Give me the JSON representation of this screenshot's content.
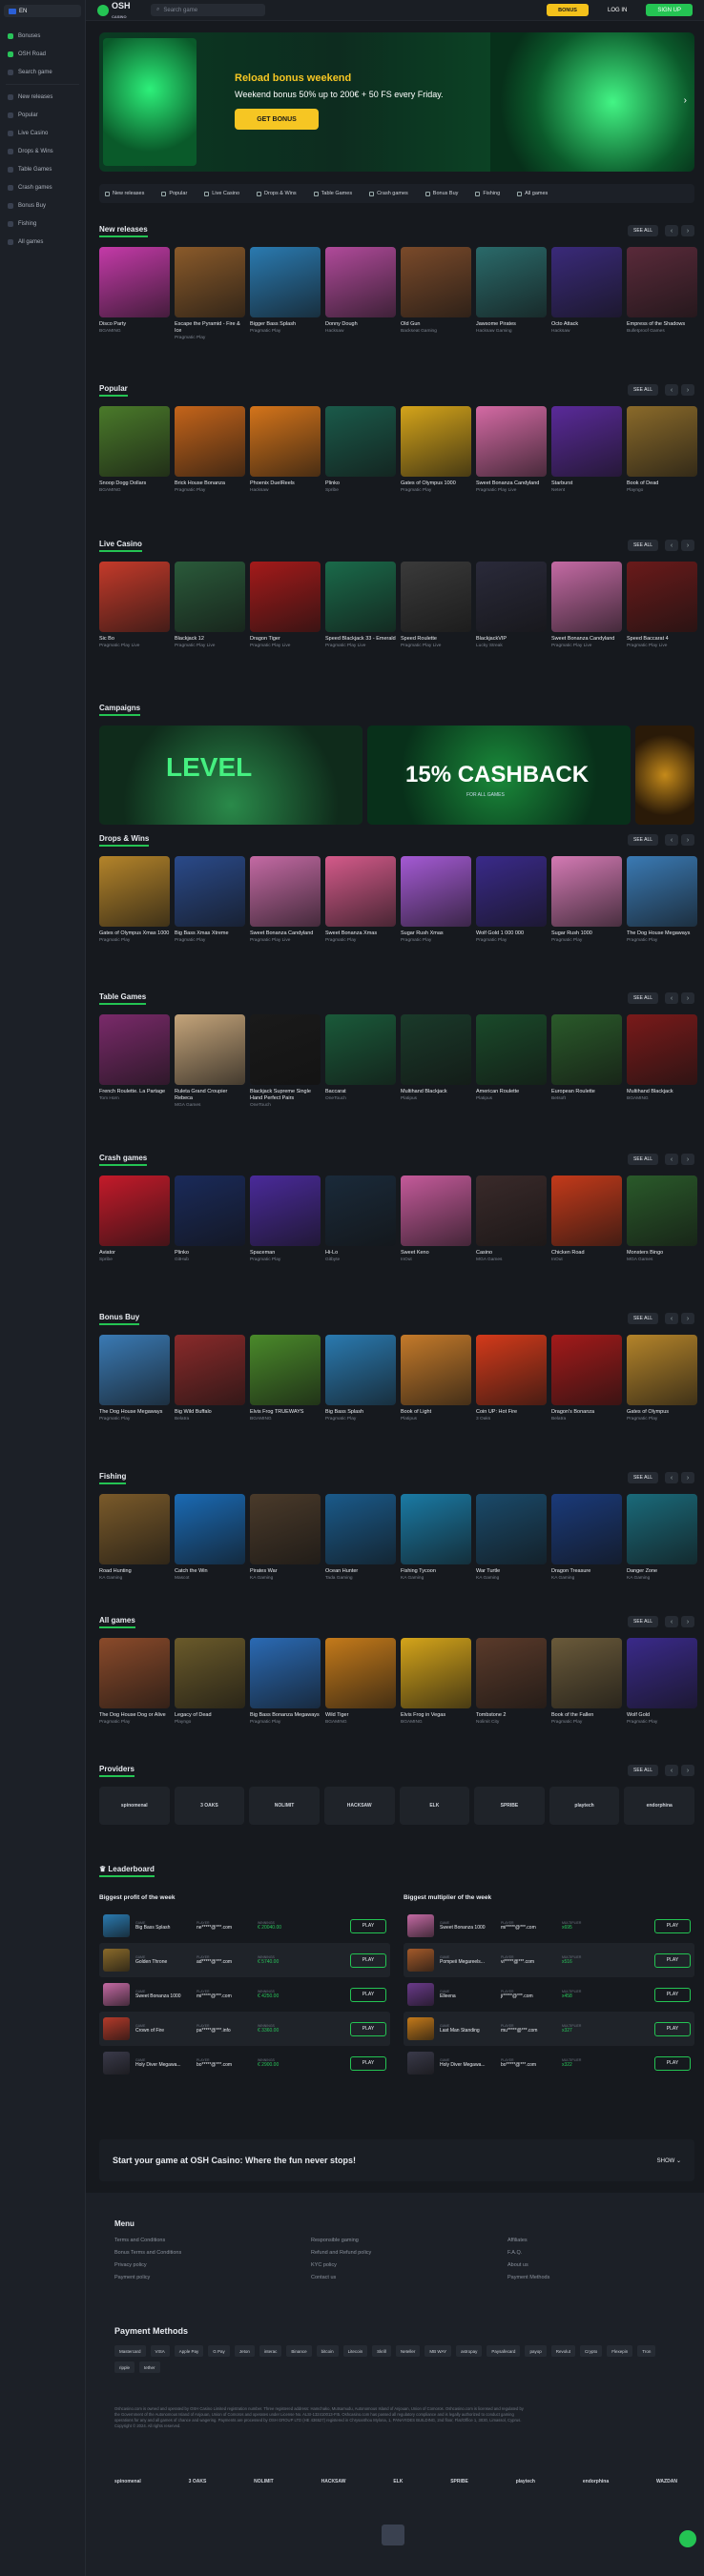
{
  "sidebar": {
    "lang": "EN",
    "items": [
      {
        "label": "Bonuses"
      },
      {
        "label": "OSH Road"
      },
      {
        "label": "Search game"
      },
      {
        "label": "New releases"
      },
      {
        "label": "Popular"
      },
      {
        "label": "Live Casino"
      },
      {
        "label": "Drops & Wins"
      },
      {
        "label": "Table Games"
      },
      {
        "label": "Crash games"
      },
      {
        "label": "Bonus Buy"
      },
      {
        "label": "Fishing"
      },
      {
        "label": "All games"
      }
    ]
  },
  "header": {
    "logo": "OSH",
    "logo_sub": "CASINO",
    "search_placeholder": "Search game",
    "bonus": "BONUS",
    "login": "LOG IN",
    "signup": "SIGN UP"
  },
  "hero": {
    "title": "Reload bonus weekend",
    "text": "Weekend bonus 50% up to 200€ + 50 FS every Friday.",
    "button": "GET BONUS"
  },
  "categories": [
    "New releases",
    "Popular",
    "Live Casino",
    "Drops & Wins",
    "Table Games",
    "Crash games",
    "Bonus Buy",
    "Fishing",
    "All games"
  ],
  "see_all": "SEE ALL",
  "sections": [
    {
      "title": "New releases",
      "games": [
        {
          "n": "Disco Party",
          "p": "BGAMING",
          "c": "#c43aa8"
        },
        {
          "n": "Escape the Pyramid - Fire & Ice",
          "p": "Pragmatic Play",
          "c": "#8a5a2a"
        },
        {
          "n": "Bigger Bass Splash",
          "p": "Pragmatic Play",
          "c": "#2a7ab0"
        },
        {
          "n": "Donny Dough",
          "p": "Hacksaw",
          "c": "#b04a9a"
        },
        {
          "n": "Old Gun",
          "p": "Backseat Gaming",
          "c": "#7a4a2a"
        },
        {
          "n": "Jawsome Pirates",
          "p": "Hacksaw Gaming",
          "c": "#2a6a6a"
        },
        {
          "n": "Octo Attack",
          "p": "Hacksaw",
          "c": "#3a2a7a"
        },
        {
          "n": "Empress of the Shadows",
          "p": "Bulletproof Games",
          "c": "#5a2a3a"
        }
      ]
    },
    {
      "title": "Popular",
      "games": [
        {
          "n": "Snoop Dogg Dollars",
          "p": "BGAMING",
          "c": "#4a7a2a"
        },
        {
          "n": "Brick House Bonanza",
          "p": "Pragmatic Play",
          "c": "#c4641a"
        },
        {
          "n": "Phoenix DuelReels",
          "p": "Hacksaw",
          "c": "#d4741a"
        },
        {
          "n": "Plinko",
          "p": "Spribe",
          "c": "#1a5a4a"
        },
        {
          "n": "Gates of Olympus 1000",
          "p": "Pragmatic Play",
          "c": "#d4a41a"
        },
        {
          "n": "Sweet Bonanza Candyland",
          "p": "Pragmatic Play Live",
          "c": "#d46aa4"
        },
        {
          "n": "Starburst",
          "p": "Netent",
          "c": "#5a2a9a"
        },
        {
          "n": "Book of Dead",
          "p": "Playngo",
          "c": "#8a6a2a"
        }
      ]
    },
    {
      "title": "Live Casino",
      "games": [
        {
          "n": "Sic Bo",
          "p": "Pragmatic Play Live",
          "c": "#c43a2a"
        },
        {
          "n": "Blackjack 12",
          "p": "Pragmatic Play Live",
          "c": "#2a5a3a"
        },
        {
          "n": "Dragon Tiger",
          "p": "Pragmatic Play Live",
          "c": "#a41a1a"
        },
        {
          "n": "Speed Blackjack 33 - Emerald",
          "p": "Pragmatic Play Live",
          "c": "#1a6a4a"
        },
        {
          "n": "Speed Roulette",
          "p": "Pragmatic Play Live",
          "c": "#3a3a3a"
        },
        {
          "n": "BlackjackVIP",
          "p": "Lucky Streak",
          "c": "#2a2a3a"
        },
        {
          "n": "Sweet Bonanza Candyland",
          "p": "Pragmatic Play Live",
          "c": "#c46aa4"
        },
        {
          "n": "Speed Baccarat 4",
          "p": "Pragmatic Play Live",
          "c": "#6a1a1a"
        }
      ]
    },
    {
      "title": "Drops & Wins",
      "games": [
        {
          "n": "Gates of Olympus Xmas 1000",
          "p": "Pragmatic Play",
          "c": "#b4842a"
        },
        {
          "n": "Big Bass Xmas Xtreme",
          "p": "Pragmatic Play",
          "c": "#2a4a8a"
        },
        {
          "n": "Sweet Bonanza Candyland",
          "p": "Pragmatic Play Live",
          "c": "#c46aa4"
        },
        {
          "n": "Sweet Bonanza Xmas",
          "p": "Pragmatic Play",
          "c": "#d45a8a"
        },
        {
          "n": "Sugar Rush Xmas",
          "p": "Pragmatic Play",
          "c": "#a45ad4"
        },
        {
          "n": "Wolf Gold 1 000 000",
          "p": "Pragmatic Play",
          "c": "#3a2a8a"
        },
        {
          "n": "Sugar Rush 1000",
          "p": "Pragmatic Play",
          "c": "#d47ab4"
        },
        {
          "n": "The Dog House Megaways",
          "p": "Pragmatic Play",
          "c": "#3a7ab4"
        }
      ]
    },
    {
      "title": "Table Games",
      "games": [
        {
          "n": "French Roulette. La Partage",
          "p": "Tom Horn",
          "c": "#7a2a6a"
        },
        {
          "n": "Ruleta Grand Croupier Rebeca",
          "p": "MGA Games",
          "c": "#c4a47a"
        },
        {
          "n": "Blackjack Supreme Single Hand Perfect Pairs",
          "p": "OneTouch",
          "c": "#1a1a1a"
        },
        {
          "n": "Baccarat",
          "p": "OneTouch",
          "c": "#1a5a3a"
        },
        {
          "n": "Multihand Blackjack",
          "p": "Platipus",
          "c": "#1a3a2a"
        },
        {
          "n": "American Roulette",
          "p": "Platipus",
          "c": "#1a4a2a"
        },
        {
          "n": "European Roulette",
          "p": "Betsoft",
          "c": "#2a5a2a"
        },
        {
          "n": "Multihand Blackjack",
          "p": "BGAMING",
          "c": "#7a1a1a"
        }
      ]
    },
    {
      "title": "Crash games",
      "games": [
        {
          "n": "Aviator",
          "p": "Spribe",
          "c": "#c41a2a"
        },
        {
          "n": "Plinko",
          "p": "GitHub",
          "c": "#1a2a5a"
        },
        {
          "n": "Spaceman",
          "p": "Pragmatic Play",
          "c": "#4a2a9a"
        },
        {
          "n": "Hi-Lo",
          "p": "Gitbyte",
          "c": "#1a2a3a"
        },
        {
          "n": "Sweet Keno",
          "p": "InOut",
          "c": "#c45a9a"
        },
        {
          "n": "Casino",
          "p": "MGA Games",
          "c": "#3a2a2a"
        },
        {
          "n": "Chicken Road",
          "p": "InOut",
          "c": "#c43a1a"
        },
        {
          "n": "Monsters Bingo",
          "p": "MGA Games",
          "c": "#2a5a2a"
        }
      ]
    },
    {
      "title": "Bonus Buy",
      "games": [
        {
          "n": "The Dog House Megaways",
          "p": "Pragmatic Play",
          "c": "#3a7ab4"
        },
        {
          "n": "Big Wild Buffalo",
          "p": "Belatra",
          "c": "#8a2a2a"
        },
        {
          "n": "Elvis Frog TRUEWAYS",
          "p": "BGAMING",
          "c": "#4a8a2a"
        },
        {
          "n": "Big Bass Splash",
          "p": "Pragmatic Play",
          "c": "#2a7ab0"
        },
        {
          "n": "Book of Light",
          "p": "Platipus",
          "c": "#c47a2a"
        },
        {
          "n": "Coin UP: Hot Fire",
          "p": "3 Oaks",
          "c": "#d43a1a"
        },
        {
          "n": "Dragon's Bonanza",
          "p": "Belatra",
          "c": "#a41a1a"
        },
        {
          "n": "Gates of Olympus",
          "p": "Pragmatic Play",
          "c": "#b4842a"
        }
      ]
    },
    {
      "title": "Fishing",
      "games": [
        {
          "n": "Road Hunting",
          "p": "KA Gaming",
          "c": "#7a5a2a"
        },
        {
          "n": "Catch the Win",
          "p": "Mascot",
          "c": "#1a6ab4"
        },
        {
          "n": "Pirates War",
          "p": "KA Gaming",
          "c": "#4a3a2a"
        },
        {
          "n": "Ocean Hunter",
          "p": "Tada Gaming",
          "c": "#1a5a8a"
        },
        {
          "n": "Fishing Tycoon",
          "p": "KA Gaming",
          "c": "#1a7aa4"
        },
        {
          "n": "War Turtle",
          "p": "KA Gaming",
          "c": "#1a4a6a"
        },
        {
          "n": "Dragon Treasure",
          "p": "KA Gaming",
          "c": "#1a3a7a"
        },
        {
          "n": "Danger Zone",
          "p": "KA Gaming",
          "c": "#1a6a7a"
        }
      ]
    },
    {
      "title": "All games",
      "games": [
        {
          "n": "The Dog House Dog or Alive",
          "p": "Pragmatic Play",
          "c": "#8a4a2a"
        },
        {
          "n": "Legacy of Dead",
          "p": "Playngo",
          "c": "#6a5a2a"
        },
        {
          "n": "Big Bass Bonanza Megaways",
          "p": "Pragmatic Play",
          "c": "#2a6ab4"
        },
        {
          "n": "Wild Tiger",
          "p": "BGAMING",
          "c": "#c47a1a"
        },
        {
          "n": "Elvis Frog in Vegas",
          "p": "BGAMING",
          "c": "#d4a41a"
        },
        {
          "n": "Tombstone 2",
          "p": "Nolimit City",
          "c": "#5a3a2a"
        },
        {
          "n": "Book of the Fallen",
          "p": "Pragmatic Play",
          "c": "#6a5a3a"
        },
        {
          "n": "Wolf Gold",
          "p": "Pragmatic Play",
          "c": "#3a2a8a"
        }
      ]
    }
  ],
  "campaigns": {
    "title": "Campaigns",
    "b1": "LEVEL",
    "b2": "15% CASHBACK",
    "b2_sub": "FOR ALL GAMES"
  },
  "providers": {
    "title": "Providers",
    "items": [
      "spinomenal",
      "3 OAKS",
      "NOLIMIT",
      "HACKSAW",
      "ELK",
      "SPRIBE",
      "playtech",
      "endorphina"
    ]
  },
  "leaderboard": {
    "title": "Leaderboard",
    "col1": "Biggest profit of the week",
    "col2": "Biggest multiplier of the week",
    "k_game": "GAME",
    "k_player": "PLAYER",
    "k_win": "WINNINGS",
    "k_mult": "MULTIPLIER",
    "play": "PLAY",
    "profit": [
      {
        "g": "Big Bass Splash",
        "u": "ne*****@***.com",
        "w": "€ 20040.00",
        "c": "#2a7ab0"
      },
      {
        "g": "Golden Throne",
        "u": "ad*****@***.com",
        "w": "€ 5740.00",
        "c": "#8a6a2a"
      },
      {
        "g": "Sweet Bonanza 1000",
        "u": "mi*****@***.com",
        "w": "€ 4250.00",
        "c": "#c46aa4"
      },
      {
        "g": "Crown of Fire",
        "u": "pa*****@***.info",
        "w": "€ 3360.00",
        "c": "#b43a2a"
      },
      {
        "g": "Holy Diver Megawa...",
        "u": "bo*****@***.com",
        "w": "€ 2900.00",
        "c": "#3a3a4a"
      }
    ],
    "mult": [
      {
        "g": "Sweet Bonanza 1000",
        "u": "mi*****@***.com",
        "w": "x695",
        "c": "#c46aa4"
      },
      {
        "g": "Pompeii Megareels...",
        "u": "vi*****@***.com",
        "w": "x516",
        "c": "#a45a2a"
      },
      {
        "g": "Elleena",
        "u": "ji*****@***.com",
        "w": "x458",
        "c": "#6a3a8a"
      },
      {
        "g": "Last Man Standing",
        "u": "mu*****@***.com",
        "w": "x327",
        "c": "#c47a1a"
      },
      {
        "g": "Holy Diver Megawa...",
        "u": "bo*****@***.com",
        "w": "x322",
        "c": "#3a3a4a"
      }
    ]
  },
  "start": {
    "text": "Start your game at OSH Casino: Where the fun never stops!",
    "show": "SHOW"
  },
  "footer": {
    "menu_title": "Menu",
    "links": [
      "Terms and Conditions",
      "Responsible gaming",
      "Affiliates",
      "Bonus Terms and Conditions",
      "Refund and Refund policy",
      "F.A.Q.",
      "Privacy policy",
      "KYC policy",
      "About us",
      "Payment policy",
      "Contact us",
      "Payment Methods"
    ],
    "pay_title": "Payment Methods",
    "payments": [
      "Mastercard",
      "VISA",
      "Apple Pay",
      "G Pay",
      "Jeton",
      "interac",
      "Binance",
      "bitcoin",
      "Litecoin",
      "Skrill",
      "Neteller",
      "MB WAY",
      "astropay",
      "Paysafecard",
      "payop",
      "Revolut",
      "Crypto",
      "Flexepin",
      "Tron",
      "ripple",
      "tether"
    ],
    "legal": "Oshcasino.com is owned and operated by OSH Casino Limited registration number. Three registered address: Hamchako, Mutsamudu, Autonomous Island of Anjouan, Union of Comoros. Oshcasino.com is licensed and regulated by the Government of the Autonomous Island of Anjouan, Union of Comoros and operates under License No. ALSI-132410013-FI5. Oshcasino.com has passed all regulatory compliance and is legally authorized to conduct gaming operations for any and all games of chance and wagering. Payments are processed by OSH GROUP LTD (HE 436527) registered in Chrysanthou Mylona, 1, PANAYIDES BUILDING, 2nd floor, Flat/Office 1, 3030, Limassol, Cyprus. Copyright © 2024. All rights reserved.",
    "providers": [
      "spinomenal",
      "3 OAKS",
      "NOLIMIT",
      "HACKSAW",
      "ELK",
      "SPRIBE",
      "playtech",
      "endorphina",
      "WAZDAN"
    ]
  }
}
